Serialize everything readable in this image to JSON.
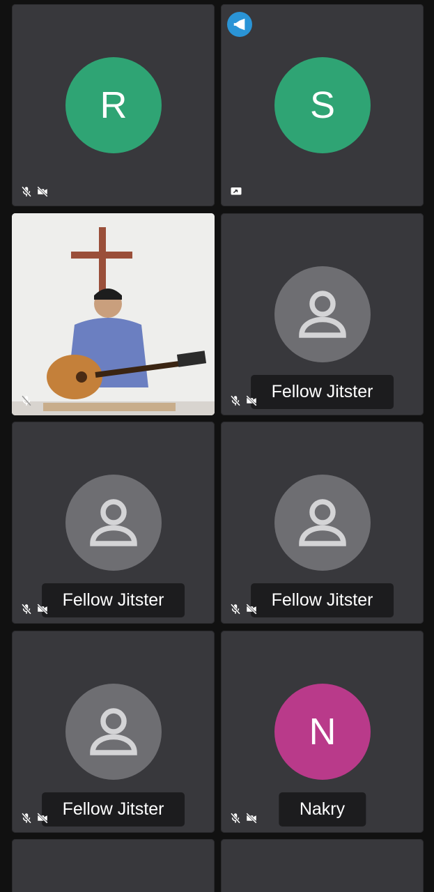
{
  "participants": [
    {
      "id": "r",
      "initial": "R",
      "name": "",
      "avatar_color": "#2fa474",
      "muted": true,
      "camera_off": true
    },
    {
      "id": "s",
      "initial": "S",
      "name": "",
      "avatar_color": "#2fa474",
      "dominant_speaker": true,
      "screen_sharing": true
    },
    {
      "id": "video",
      "name": "",
      "muted": true,
      "has_video": true
    },
    {
      "id": "fj1",
      "name": "Fellow Jitster",
      "muted": true,
      "camera_off": true
    },
    {
      "id": "fj2",
      "name": "Fellow Jitster",
      "muted": true,
      "camera_off": true
    },
    {
      "id": "fj3",
      "name": "Fellow Jitster",
      "muted": true,
      "camera_off": true
    },
    {
      "id": "fj4",
      "name": "Fellow Jitster",
      "muted": true,
      "camera_off": true
    },
    {
      "id": "n",
      "initial": "N",
      "name": "Nakry",
      "avatar_color": "#b93a8a",
      "muted": true,
      "camera_off": true
    }
  ],
  "colors": {
    "background": "#111111",
    "tile": "#38383c",
    "default_avatar": "#6e6e72",
    "label_bg": "#1c1c1e",
    "speaker_badge": "#2a94d6"
  },
  "icons": {
    "mic_off": "mic-off-icon",
    "camera_off": "camera-off-icon",
    "screen_share": "screen-share-icon",
    "dominant_speaker": "megaphone-icon",
    "default_avatar": "person-icon"
  }
}
